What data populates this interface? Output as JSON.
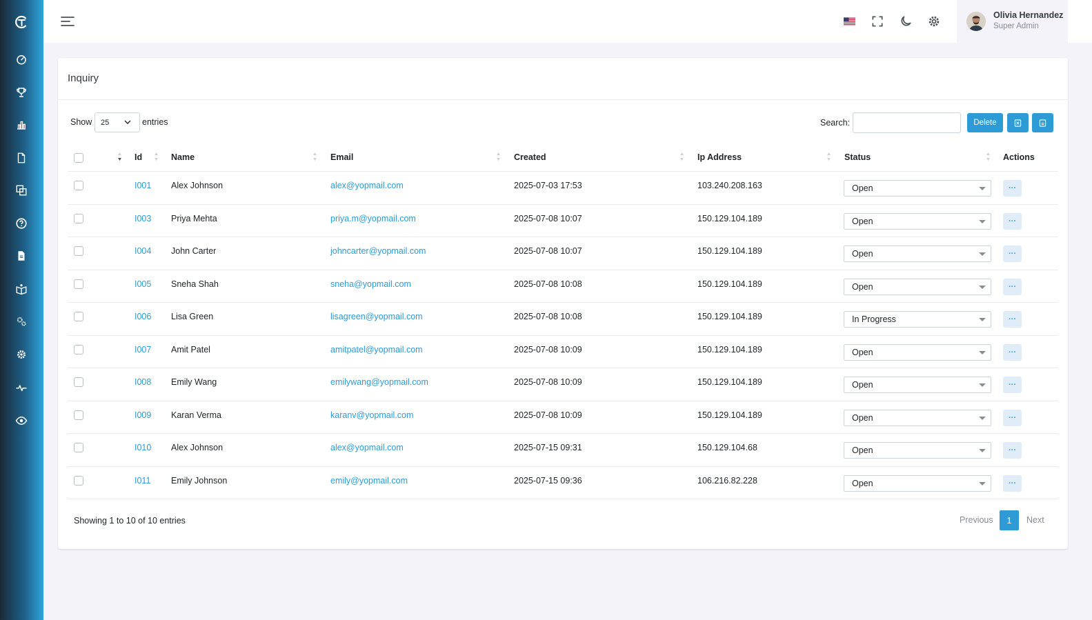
{
  "sidebar": {
    "logo_icon": "brand-logo",
    "items": [
      {
        "icon": "gauge-icon"
      },
      {
        "icon": "trophy-icon"
      },
      {
        "icon": "bar-chart-icon"
      },
      {
        "icon": "document-icon"
      },
      {
        "icon": "translate-icon"
      },
      {
        "icon": "help-circle-icon"
      },
      {
        "icon": "blog-icon"
      },
      {
        "icon": "open-book-icon"
      },
      {
        "icon": "cogs-icon"
      },
      {
        "icon": "settings-icon"
      },
      {
        "icon": "pulse-icon"
      },
      {
        "icon": "eye-icon"
      }
    ]
  },
  "topbar": {
    "icons": [
      "menu-icon",
      "us-flag-icon",
      "fullscreen-icon",
      "moon-icon",
      "gear-icon"
    ],
    "user": {
      "name": "Olivia Hernandez",
      "role": "Super Admin"
    }
  },
  "page": {
    "title": "Inquiry",
    "length": {
      "show": "Show",
      "value": "25",
      "entries": "entries"
    },
    "search_label": "Search:",
    "search_value": "",
    "delete_label": "Delete",
    "export_icons": [
      "excel-export-icon",
      "csv-export-icon"
    ]
  },
  "table": {
    "headers": {
      "id": "Id",
      "name": "Name",
      "email": "Email",
      "created": "Created",
      "ip": "Ip Address",
      "status": "Status",
      "actions": "Actions"
    },
    "action_label": "···",
    "rows": [
      {
        "id": "I001",
        "name": "Alex Johnson",
        "email": "alex@yopmail.com",
        "created": "2025-07-03 17:53",
        "ip": "103.240.208.163",
        "status": "Open"
      },
      {
        "id": "I003",
        "name": "Priya Mehta",
        "email": "priya.m@yopmail.com",
        "created": "2025-07-08 10:07",
        "ip": "150.129.104.189",
        "status": "Open"
      },
      {
        "id": "I004",
        "name": "John Carter",
        "email": "johncarter@yopmail.com",
        "created": "2025-07-08 10:07",
        "ip": "150.129.104.189",
        "status": "Open"
      },
      {
        "id": "I005",
        "name": "Sneha Shah",
        "email": "sneha@yopmail.com",
        "created": "2025-07-08 10:08",
        "ip": "150.129.104.189",
        "status": "Open"
      },
      {
        "id": "I006",
        "name": "Lisa Green",
        "email": "lisagreen@yopmail.com",
        "created": "2025-07-08 10:08",
        "ip": "150.129.104.189",
        "status": "In Progress"
      },
      {
        "id": "I007",
        "name": "Amit Patel",
        "email": "amitpatel@yopmail.com",
        "created": "2025-07-08 10:09",
        "ip": "150.129.104.189",
        "status": "Open"
      },
      {
        "id": "I008",
        "name": "Emily Wang",
        "email": "emilywang@yopmail.com",
        "created": "2025-07-08 10:09",
        "ip": "150.129.104.189",
        "status": "Open"
      },
      {
        "id": "I009",
        "name": "Karan Verma",
        "email": "karanv@yopmail.com",
        "created": "2025-07-08 10:09",
        "ip": "150.129.104.189",
        "status": "Open"
      },
      {
        "id": "I010",
        "name": "Alex Johnson",
        "email": "alex@yopmail.com",
        "created": "2025-07-15 09:31",
        "ip": "150.129.104.68",
        "status": "Open"
      },
      {
        "id": "I011",
        "name": "Emily Johnson",
        "email": "emily@yopmail.com",
        "created": "2025-07-15 09:36",
        "ip": "106.216.82.228",
        "status": "Open"
      }
    ]
  },
  "footer": {
    "info": "Showing 1 to 10 of 10 entries",
    "prev": "Previous",
    "page": "1",
    "next": "Next"
  },
  "colors": {
    "accent": "#2c9bd6",
    "sidebar_dark": "#1b2a38",
    "sidebar_light": "#2fa4de"
  }
}
